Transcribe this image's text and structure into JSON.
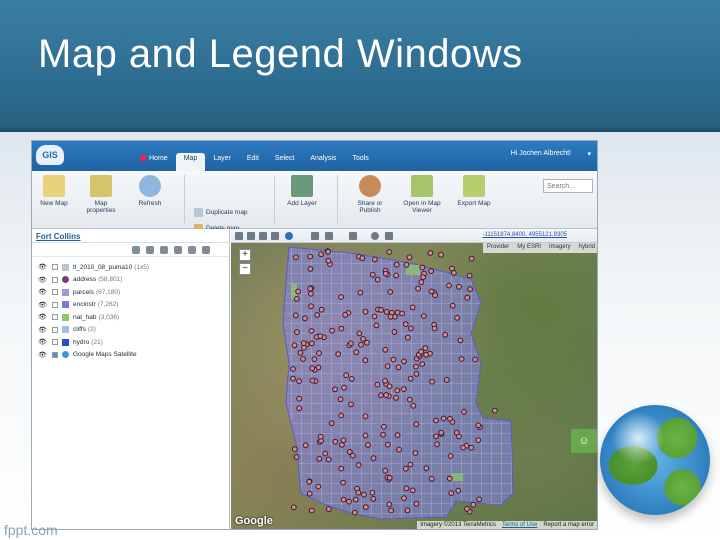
{
  "slide": {
    "title": "Map and Legend Windows",
    "watermark": "fppt.com"
  },
  "app": {
    "logo": "GIS",
    "tabs": [
      {
        "label": "Home",
        "active": false
      },
      {
        "label": "Map",
        "active": true
      },
      {
        "label": "Layer",
        "active": false
      },
      {
        "label": "Edit",
        "active": false
      },
      {
        "label": "Select",
        "active": false
      },
      {
        "label": "Analysis",
        "active": false
      },
      {
        "label": "Tools",
        "active": false
      }
    ],
    "user_greeting": "Hi Jochen Albrecht!",
    "user_caret": "▾",
    "ribbon": {
      "new_map": "New Map",
      "map_properties": "Map properties",
      "refresh": "Refresh",
      "duplicate_map": "Duplicate map",
      "delete_map": "Delete map",
      "add_layer": "Add Layer",
      "share_publish": "Share or Publish",
      "open_map_viewer": "Open in Map Viewer",
      "export_map": "Export Map",
      "search_placeholder": "Search..."
    },
    "left_panel": {
      "map_name": "Fort Collins",
      "layers": [
        {
          "name": "tl_2010_08_puma10",
          "count": "(1x5)",
          "color": "#b9c4d3",
          "checked": false
        },
        {
          "name": "address",
          "count": "(58,801)",
          "color": "#7a3b7d",
          "checked": false
        },
        {
          "name": "parcels",
          "count": "(67,180)",
          "color": "#9a9ae0",
          "checked": false
        },
        {
          "name": "encinstr",
          "count": "(7,262)",
          "color": "#7a7ad8",
          "checked": false
        },
        {
          "name": "nat_hab",
          "count": "(3,036)",
          "color": "#8cc76a",
          "checked": false
        },
        {
          "name": "cliffs",
          "count": "(2)",
          "color": "#9fc0e8",
          "checked": false
        },
        {
          "name": "hydro",
          "count": "(21)",
          "color": "#2a4fc2",
          "checked": false
        },
        {
          "name": "Google Maps Satellite",
          "count": "",
          "color": "#3a9ad9",
          "checked": true
        }
      ]
    },
    "map": {
      "coordinates": "-11151874.8400, 4955121.9305",
      "bar_items": [
        "Provider",
        "My ESRI",
        "Imagery",
        "hybrid"
      ],
      "zoom_in": "+",
      "zoom_out": "−",
      "google_label": "Google",
      "attribution": [
        "Imagery ©2013 TerraMetrics",
        "Terms of Use",
        "Report a map error"
      ],
      "feedback_icon": "☺"
    }
  }
}
